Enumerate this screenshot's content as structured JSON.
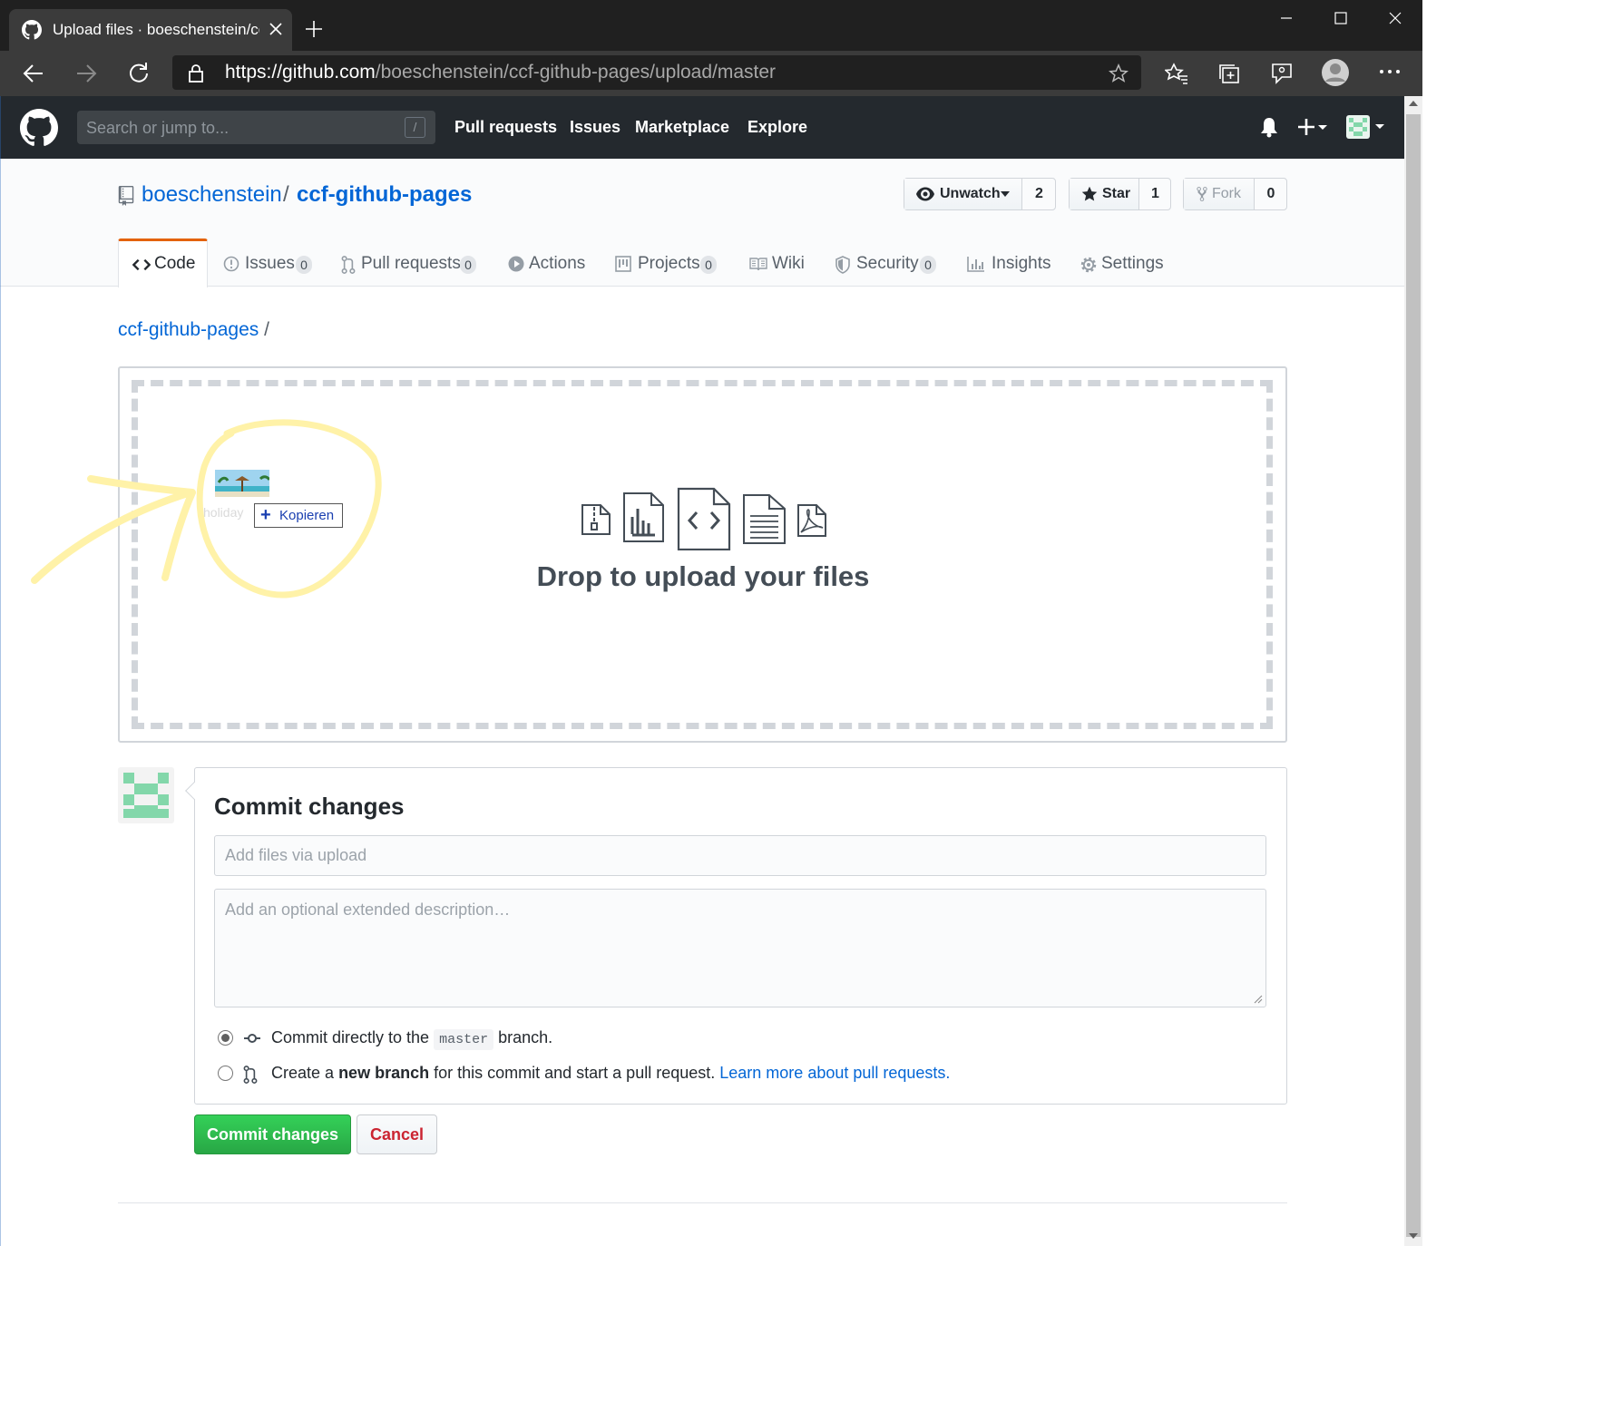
{
  "browser": {
    "tab_title": "Upload files · boeschenstein/ccf-",
    "url_host": "https://github.com",
    "url_path": "/boeschenstein/ccf-github-pages/upload/master"
  },
  "gh_header": {
    "search_placeholder": "Search or jump to...",
    "search_shortcut": "/",
    "nav": [
      "Pull requests",
      "Issues",
      "Marketplace",
      "Explore"
    ]
  },
  "repo": {
    "owner": "boeschenstein",
    "separator": "/",
    "name": "ccf-github-pages",
    "unwatch_label": "Unwatch",
    "watch_count": "2",
    "star_label": "Star",
    "star_count": "1",
    "fork_label": "Fork",
    "fork_count": "0"
  },
  "tabs": [
    {
      "label": "Code",
      "icon": "code-icon"
    },
    {
      "label": "Issues",
      "counter": "0",
      "icon": "issue-icon"
    },
    {
      "label": "Pull requests",
      "counter": "0",
      "icon": "pull-request-icon"
    },
    {
      "label": "Actions",
      "icon": "play-icon"
    },
    {
      "label": "Projects",
      "counter": "0",
      "icon": "project-icon"
    },
    {
      "label": "Wiki",
      "icon": "book-icon"
    },
    {
      "label": "Security",
      "counter": "0",
      "icon": "shield-icon"
    },
    {
      "label": "Insights",
      "icon": "graph-icon"
    },
    {
      "label": "Settings",
      "icon": "gear-icon"
    }
  ],
  "breadcrumb": {
    "repo": "ccf-github-pages",
    "sep": "/"
  },
  "upload": {
    "drop_text": "Drop to upload your files",
    "drag_file_name": "holiday",
    "drag_action": "Kopieren"
  },
  "commit": {
    "title": "Commit changes",
    "summary_placeholder": "Add files via upload",
    "description_placeholder": "Add an optional extended description…",
    "option_direct_before": "Commit directly to the",
    "option_direct_branch": "master",
    "option_direct_after": "branch.",
    "option_new_before": "Create a",
    "option_new_bold": "new branch",
    "option_new_after": "for this commit and start a pull request.",
    "learn_more": "Learn more about pull requests.",
    "submit_label": "Commit changes",
    "cancel_label": "Cancel"
  },
  "colors": {
    "accent_link": "#0366d6",
    "commit_green": "#28a745",
    "cancel_red": "#cb2431",
    "tab_selected": "#e36209",
    "annotation_yellow": "#fff2a8"
  }
}
